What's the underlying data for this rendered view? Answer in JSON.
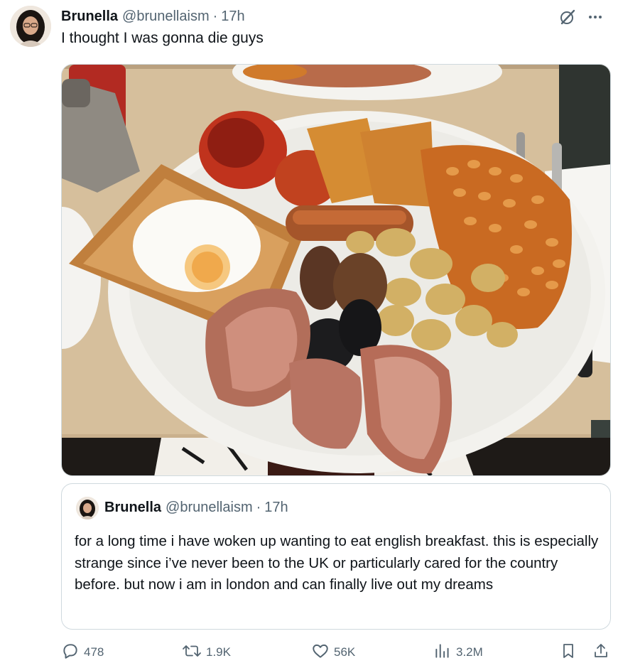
{
  "tweet": {
    "author_name": "Brunella",
    "author_handle": "@brunellaism",
    "separator": "·",
    "time": "17h",
    "text": "I thought I was gonna die guys"
  },
  "quoted_tweet": {
    "author_name": "Brunella",
    "author_handle": "@brunellaism",
    "separator": "·",
    "time": "17h",
    "text": "for a long time i have woken up wanting to eat english breakfast. this is especially strange since i’ve never been to the UK or particularly cared for the country before.  but now i am in london and can finally live out my dreams"
  },
  "actions": {
    "replies": "478",
    "reposts": "1.9K",
    "likes": "56K",
    "views": "3.2M"
  },
  "icons": {
    "header": [
      "grok-icon",
      "more-icon"
    ],
    "actions": [
      "reply-icon",
      "repost-icon",
      "like-icon",
      "views-icon",
      "bookmark-icon",
      "share-icon"
    ]
  },
  "colors": {
    "text": "#0f1419",
    "secondary": "#536471",
    "border": "#cfd9de"
  }
}
